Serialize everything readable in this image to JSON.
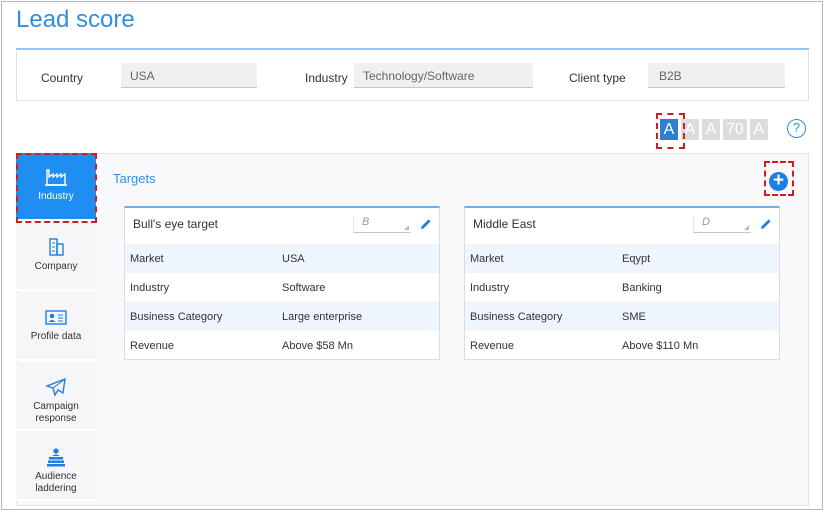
{
  "page": {
    "title": "Lead score"
  },
  "filters": [
    {
      "label": "Country",
      "value": "USA"
    },
    {
      "label": "Industry",
      "value": "Technology/Software"
    },
    {
      "label": "Client type",
      "value": "B2B"
    }
  ],
  "grades": [
    "A",
    "A",
    "A",
    "70",
    "A"
  ],
  "help": {
    "glyph": "?"
  },
  "nav": [
    {
      "label": "Industry",
      "icon": "factory-icon",
      "active": true
    },
    {
      "label": "Company",
      "icon": "building-icon"
    },
    {
      "label": "Profile data",
      "icon": "id-card-icon"
    },
    {
      "label": "Campaign response",
      "line1": "Campaign",
      "line2": "response",
      "icon": "paper-plane-icon"
    },
    {
      "label": "Audience laddering",
      "line1": "Audience",
      "line2": "laddering",
      "icon": "stacked-person-icon"
    }
  ],
  "targets": {
    "title": "Targets",
    "add_glyph": "+",
    "cards": [
      {
        "name": "Bull's eye target",
        "grade": "B",
        "rows": [
          {
            "key": "Market",
            "value": "USA"
          },
          {
            "key": "Industry",
            "value": "Software"
          },
          {
            "key": "Business Category",
            "value": "Large enterprise"
          },
          {
            "key": "Revenue",
            "value": "Above $58 Mn"
          }
        ]
      },
      {
        "name": "Middle East",
        "grade": "D",
        "rows": [
          {
            "key": "Market",
            "value": "Eqypt"
          },
          {
            "key": "Industry",
            "value": "Banking"
          },
          {
            "key": "Business Category",
            "value": "SME"
          },
          {
            "key": "Revenue",
            "value": "Above $110 Mn"
          }
        ]
      }
    ]
  },
  "colors": {
    "accent": "#2f8fe6",
    "active_nav": "#1e8ef2",
    "annotation": "#cc1f1f"
  }
}
